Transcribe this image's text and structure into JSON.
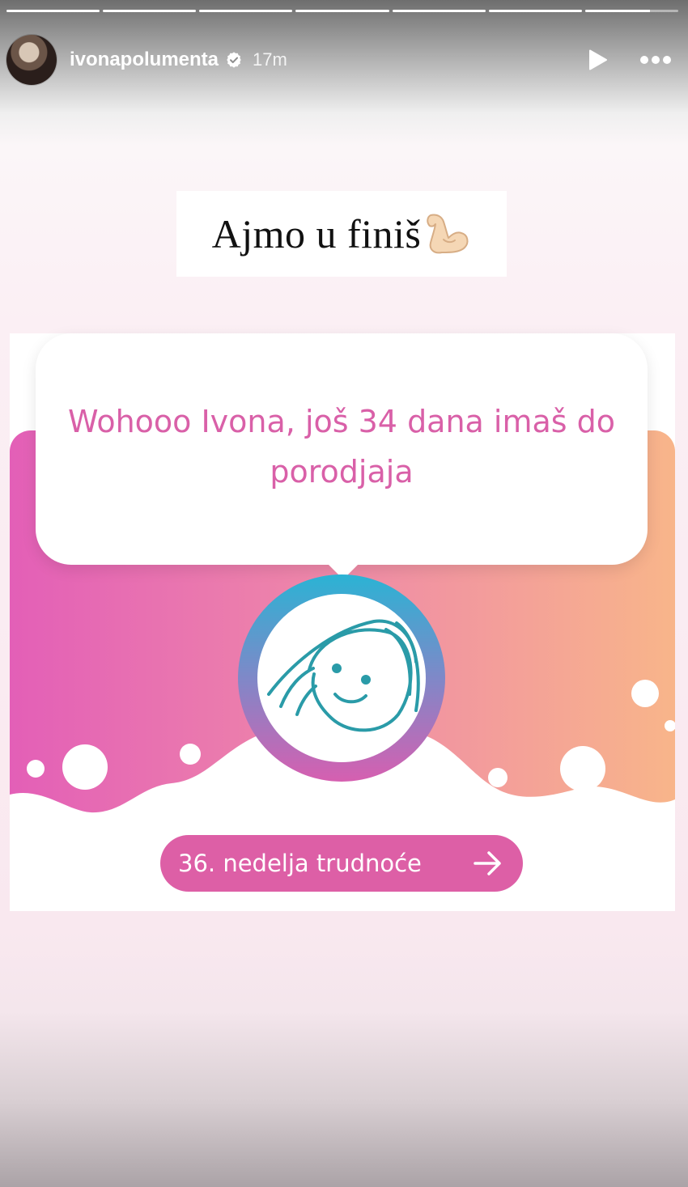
{
  "story": {
    "segments": [
      1,
      1,
      1,
      1,
      1,
      1,
      0.7
    ],
    "user": {
      "username": "ivonapolumenta",
      "time": "17m",
      "avatar_icon": "profile-photo",
      "verified_icon": "verified-badge-icon"
    },
    "controls": {
      "play_icon": "play-icon",
      "more_icon": "more-options-icon"
    }
  },
  "caption": {
    "text": "Ajmo u finiš",
    "emoji_icon": "flexed-biceps-icon"
  },
  "card": {
    "bubble_text": "Wohooo Ivona, još 34 dana imaš do porodjaja",
    "baby_icon": "baby-face-icon",
    "button_label": "36. nedelja trudnoće",
    "button_icon": "arrow-right-icon",
    "colors": {
      "pink": "#dd5fa6",
      "peach": "#f7b08c",
      "ring_top": "#2bb3d4",
      "ring_bottom": "#d65fb0",
      "baby_line": "#2a9ba8"
    }
  }
}
